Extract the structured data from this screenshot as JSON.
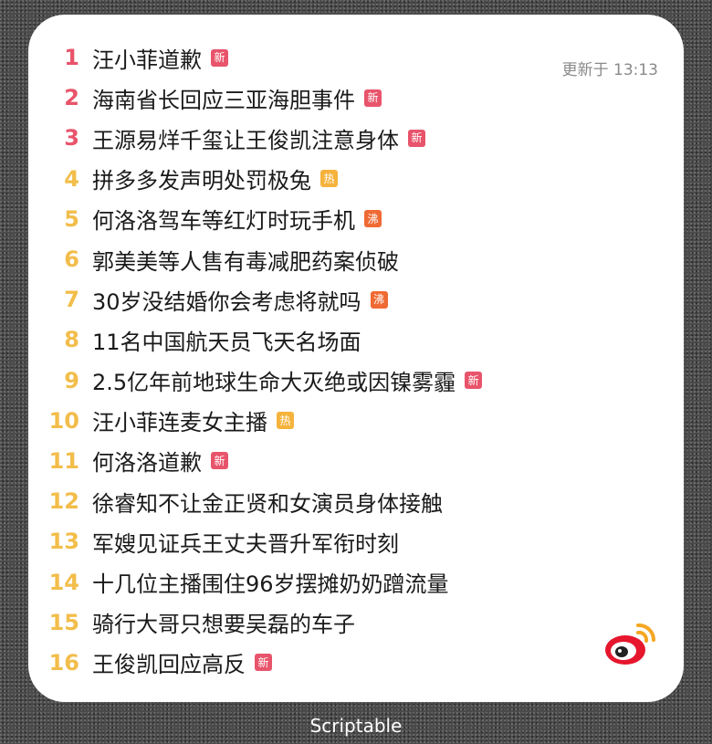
{
  "widget": {
    "updated_text": "更新于 13:13",
    "colors": {
      "rank_top": "#e8546b",
      "rank_other": "#f2bd4a",
      "badge_new": "#e8546b",
      "badge_hot": "#f5b33c",
      "badge_boil": "#f06a33"
    },
    "items": [
      {
        "rank": "1",
        "title": "汪小菲道歉",
        "badge": "新",
        "badge_type": "new"
      },
      {
        "rank": "2",
        "title": "海南省长回应三亚海胆事件",
        "badge": "新",
        "badge_type": "new"
      },
      {
        "rank": "3",
        "title": "王源易烊千玺让王俊凯注意身体",
        "badge": "新",
        "badge_type": "new"
      },
      {
        "rank": "4",
        "title": "拼多多发声明处罚极兔",
        "badge": "热",
        "badge_type": "hot"
      },
      {
        "rank": "5",
        "title": "何洛洛驾车等红灯时玩手机",
        "badge": "沸",
        "badge_type": "boil"
      },
      {
        "rank": "6",
        "title": "郭美美等人售有毒减肥药案侦破",
        "badge": "",
        "badge_type": ""
      },
      {
        "rank": "7",
        "title": "30岁没结婚你会考虑将就吗",
        "badge": "沸",
        "badge_type": "boil"
      },
      {
        "rank": "8",
        "title": "11名中国航天员飞天名场面",
        "badge": "",
        "badge_type": ""
      },
      {
        "rank": "9",
        "title": "2.5亿年前地球生命大灭绝或因镍雾霾",
        "badge": "新",
        "badge_type": "new"
      },
      {
        "rank": "10",
        "title": "汪小菲连麦女主播",
        "badge": "热",
        "badge_type": "hot"
      },
      {
        "rank": "11",
        "title": "何洛洛道歉",
        "badge": "新",
        "badge_type": "new"
      },
      {
        "rank": "12",
        "title": "徐睿知不让金正贤和女演员身体接触",
        "badge": "",
        "badge_type": ""
      },
      {
        "rank": "13",
        "title": "军嫂见证兵王丈夫晋升军衔时刻",
        "badge": "",
        "badge_type": ""
      },
      {
        "rank": "14",
        "title": "十几位主播围住96岁摆摊奶奶蹭流量",
        "badge": "",
        "badge_type": ""
      },
      {
        "rank": "15",
        "title": "骑行大哥只想要吴磊的车子",
        "badge": "",
        "badge_type": ""
      },
      {
        "rank": "16",
        "title": "王俊凯回应高反",
        "badge": "新",
        "badge_type": "new"
      }
    ],
    "logo_icon": "weibo-logo-icon"
  },
  "app_label": "Scriptable"
}
